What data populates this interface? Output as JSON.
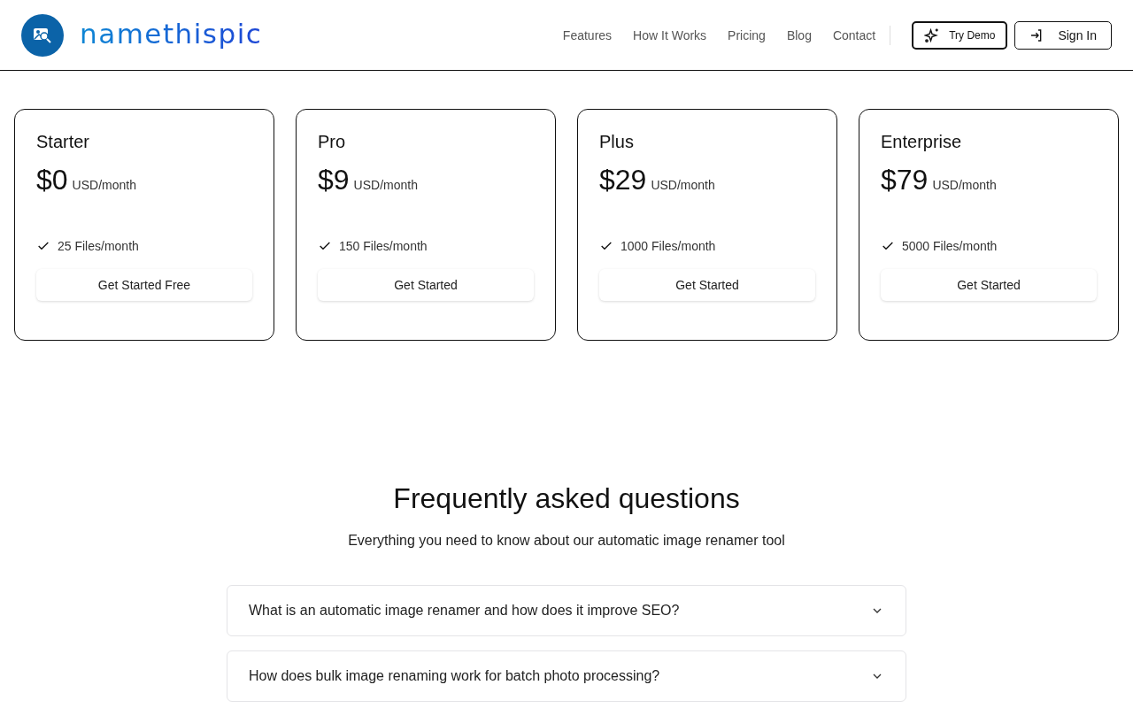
{
  "header": {
    "logo": "namethispic",
    "nav": [
      "Features",
      "How It Works",
      "Pricing",
      "Blog",
      "Contact"
    ],
    "buttons": [
      {
        "kind": "demo",
        "label": "Try Demo"
      },
      {
        "kind": "signin",
        "label": "Sign In"
      }
    ]
  },
  "plans": [
    {
      "name": "Starter",
      "price": "$0",
      "period": "USD/month",
      "feature": "25 Files/month",
      "button": "Get Started Free"
    },
    {
      "name": "Pro",
      "price": "$9",
      "period": "USD/month",
      "feature": "150 Files/month",
      "button": "Get Started"
    },
    {
      "name": "Plus",
      "price": "$29",
      "period": "USD/month",
      "feature": "1000 Files/month",
      "button": "Get Started"
    },
    {
      "name": "Enterprise",
      "price": "$79",
      "period": "USD/month",
      "feature": "5000 Files/month",
      "button": "Get Started"
    }
  ],
  "faq": {
    "title": "Frequently asked questions",
    "subtitle": "Everything you need to know about our automatic image renamer tool",
    "items": [
      {
        "question": "What is an automatic image renamer and how does it improve SEO?",
        "expanded": false
      },
      {
        "question": "How does bulk image renaming work for batch photo processing?",
        "expanded": false
      }
    ]
  }
}
